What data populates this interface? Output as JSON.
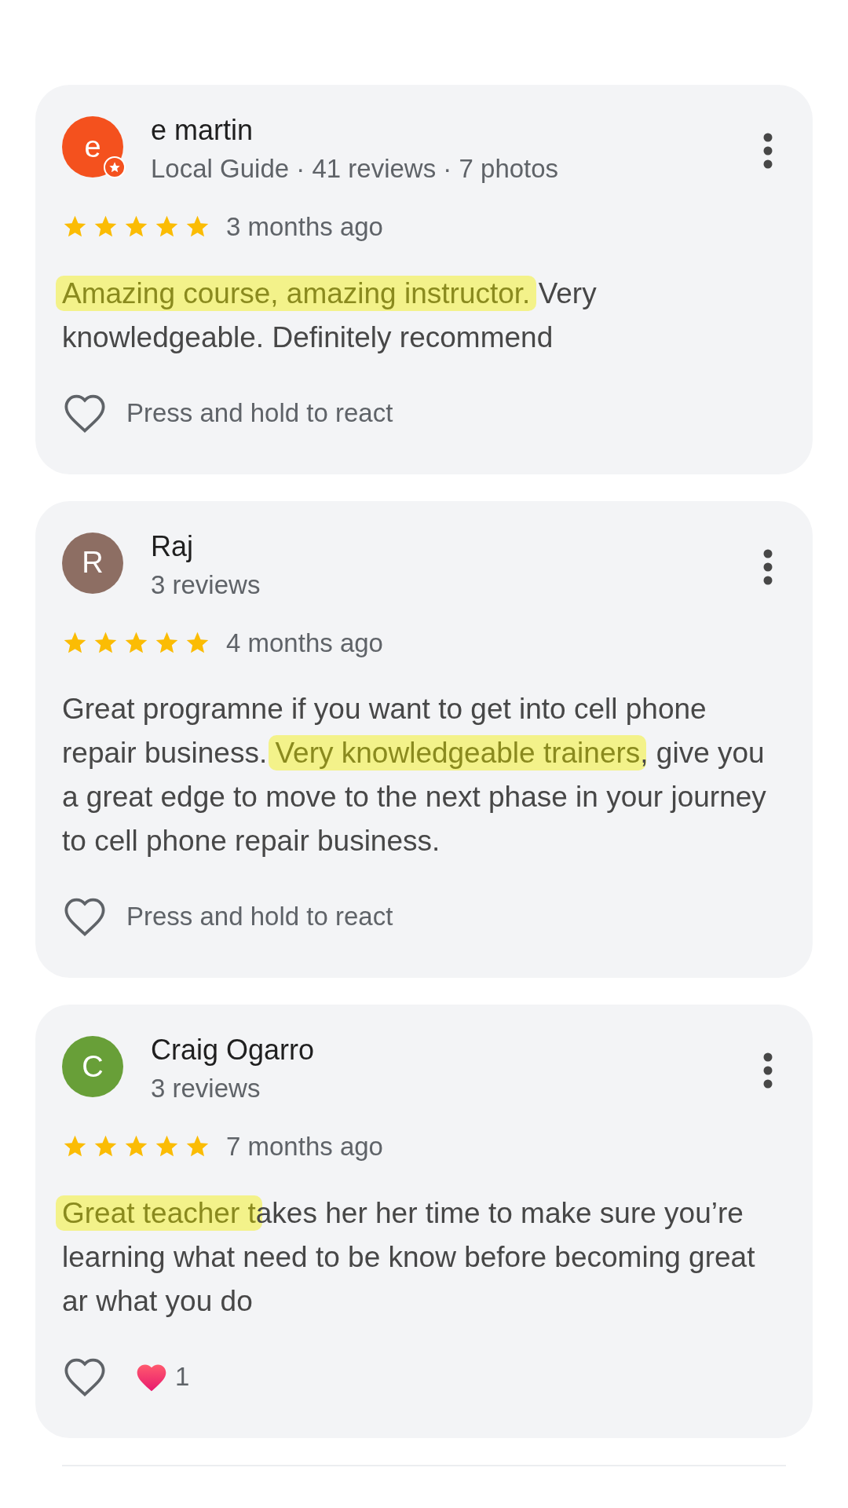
{
  "reviews": [
    {
      "avatar": {
        "letter": "e",
        "color": "#f4511e",
        "local_guide": true
      },
      "name": "e martin",
      "meta": "Local Guide · 41 reviews · 7 photos",
      "stars": 5,
      "time": "3 months ago",
      "body": [
        {
          "text": "Amazing course, amazing instructor.",
          "highlighted": true
        },
        {
          "text": " Very knowledgeable. Definitely recommend",
          "highlighted": false
        }
      ],
      "reaction": {
        "hint": "Press and hold to react"
      }
    },
    {
      "avatar": {
        "letter": "R",
        "color": "#8d6e63",
        "local_guide": false
      },
      "name": "Raj",
      "meta": "3 reviews",
      "stars": 5,
      "time": "4 months ago",
      "body": [
        {
          "text": "Great programne if you want to get into cell phone repair business. ",
          "highlighted": false
        },
        {
          "text": "Very knowledgeable trainers",
          "highlighted": true
        },
        {
          "text": ", give you a great edge to move to the next phase in your journey to cell phone repair business.",
          "highlighted": false
        }
      ],
      "reaction": {
        "hint": "Press and hold to react"
      }
    },
    {
      "avatar": {
        "letter": "C",
        "color": "#689f38",
        "local_guide": false
      },
      "name": "Craig Ogarro",
      "meta": "3 reviews",
      "stars": 5,
      "time": "7 months ago",
      "body": [
        {
          "text": "Great teacher t",
          "highlighted": true
        },
        {
          "text": "akes her her time to make sure you’re learning what need to be know before becoming great ar what you do",
          "highlighted": false
        }
      ],
      "reaction": {
        "count": "1"
      }
    }
  ]
}
